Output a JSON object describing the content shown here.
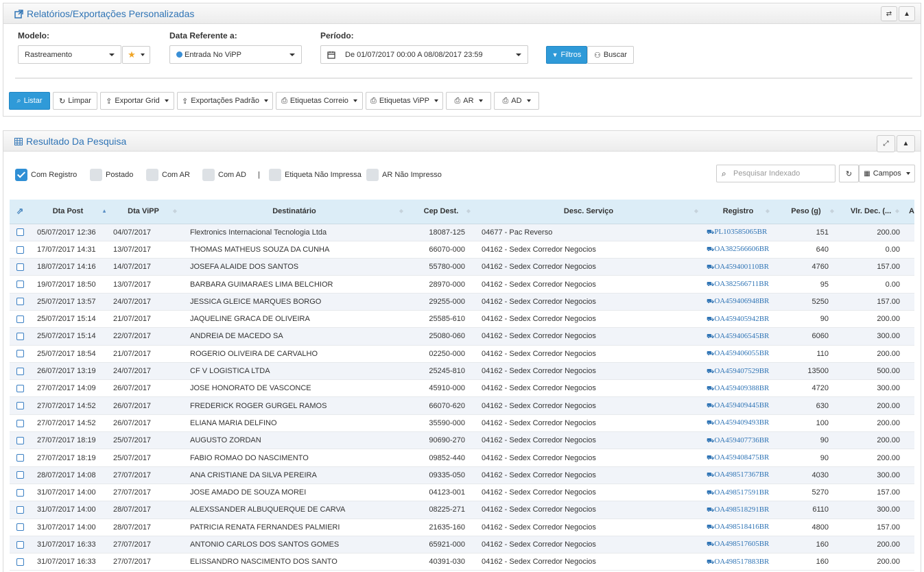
{
  "top_panel": {
    "title": "Relatórios/Exportações Personalizadas",
    "modelo": {
      "label": "Modelo:",
      "value": "Rastreamento"
    },
    "data_ref": {
      "label": "Data Referente a:",
      "value": "Entrada No ViPP"
    },
    "periodo": {
      "label": "Período:",
      "value": "De 01/07/2017 00:00 A 08/08/2017 23:59"
    },
    "filtros_label": "Filtros",
    "buscar_label": "Buscar",
    "toolbar": {
      "listar": "Listar",
      "limpar": "Limpar",
      "exportar_grid": "Exportar Grid",
      "exportacoes_padrao": "Exportações Padrão",
      "etiquetas_correio": "Etiquetas Correio",
      "etiquetas_vipp": "Etiquetas ViPP",
      "ar": "AR",
      "ad": "AD"
    }
  },
  "result_panel": {
    "title": "Resultado Da Pesquisa",
    "filters": [
      {
        "label": "Com Registro",
        "checked": true
      },
      {
        "label": "Postado",
        "checked": false
      },
      {
        "label": "Com AR",
        "checked": false
      },
      {
        "label": "Com AD",
        "checked": false
      },
      {
        "label": "Etiqueta Não Impressa",
        "checked": false
      },
      {
        "label": "AR Não Impresso",
        "checked": false
      }
    ],
    "separator": "|",
    "search_placeholder": "Pesquisar Indexado",
    "campos_label": "Campos",
    "columns": [
      "Dta Post",
      "Dta ViPP",
      "Destinatário",
      "Cep Dest.",
      "Desc. Serviço",
      "Registro",
      "Peso (g)",
      "Vlr. Dec. (...",
      "Adic"
    ],
    "rows": [
      [
        "05/07/2017 12:36",
        "04/07/2017",
        "Flextronics Internacional Tecnologia Ltda",
        "18087-125",
        "04677 - Pac Reverso",
        "PL103585065BR",
        "151",
        "200.00"
      ],
      [
        "17/07/2017 14:31",
        "13/07/2017",
        "THOMAS MATHEUS SOUZA DA CUNHA",
        "66070-000",
        "04162 - Sedex Corredor Negocios",
        "OA382566606BR",
        "640",
        "0.00"
      ],
      [
        "18/07/2017 14:16",
        "14/07/2017",
        "JOSEFA ALAIDE DOS SANTOS",
        "55780-000",
        "04162 - Sedex Corredor Negocios",
        "OA459400110BR",
        "4760",
        "157.00"
      ],
      [
        "19/07/2017 18:50",
        "13/07/2017",
        "BARBARA GUIMARAES LIMA BELCHIOR",
        "28970-000",
        "04162 - Sedex Corredor Negocios",
        "OA382566711BR",
        "95",
        "0.00"
      ],
      [
        "25/07/2017 13:57",
        "24/07/2017",
        "JESSICA GLEICE MARQUES BORGO",
        "29255-000",
        "04162 - Sedex Corredor Negocios",
        "OA459406948BR",
        "5250",
        "157.00"
      ],
      [
        "25/07/2017 15:14",
        "21/07/2017",
        "JAQUELINE GRACA DE OLIVEIRA",
        "25585-610",
        "04162 - Sedex Corredor Negocios",
        "OA459405942BR",
        "90",
        "200.00"
      ],
      [
        "25/07/2017 15:14",
        "22/07/2017",
        "ANDREIA DE MACEDO SA",
        "25080-060",
        "04162 - Sedex Corredor Negocios",
        "OA459406545BR",
        "6060",
        "300.00"
      ],
      [
        "25/07/2017 18:54",
        "21/07/2017",
        "ROGERIO OLIVEIRA DE CARVALHO",
        "02250-000",
        "04162 - Sedex Corredor Negocios",
        "OA459406055BR",
        "110",
        "200.00"
      ],
      [
        "26/07/2017 13:19",
        "24/07/2017",
        "CF V LOGISTICA LTDA",
        "25245-810",
        "04162 - Sedex Corredor Negocios",
        "OA459407529BR",
        "13500",
        "500.00"
      ],
      [
        "27/07/2017 14:09",
        "26/07/2017",
        "JOSE HONORATO DE VASCONCE",
        "45910-000",
        "04162 - Sedex Corredor Negocios",
        "OA459409388BR",
        "4720",
        "300.00"
      ],
      [
        "27/07/2017 14:52",
        "26/07/2017",
        "FREDERICK ROGER GURGEL RAMOS",
        "66070-620",
        "04162 - Sedex Corredor Negocios",
        "OA459409445BR",
        "630",
        "200.00"
      ],
      [
        "27/07/2017 14:52",
        "26/07/2017",
        "ELIANA MARIA DELFINO",
        "35590-000",
        "04162 - Sedex Corredor Negocios",
        "OA459409493BR",
        "100",
        "200.00"
      ],
      [
        "27/07/2017 18:19",
        "25/07/2017",
        "AUGUSTO ZORDAN",
        "90690-270",
        "04162 - Sedex Corredor Negocios",
        "OA459407736BR",
        "90",
        "200.00"
      ],
      [
        "27/07/2017 18:19",
        "25/07/2017",
        "FABIO ROMAO DO NASCIMENTO",
        "09852-440",
        "04162 - Sedex Corredor Negocios",
        "OA459408475BR",
        "90",
        "200.00"
      ],
      [
        "28/07/2017 14:08",
        "27/07/2017",
        "ANA CRISTIANE DA SILVA PEREIRA",
        "09335-050",
        "04162 - Sedex Corredor Negocios",
        "OA498517367BR",
        "4030",
        "300.00"
      ],
      [
        "31/07/2017 14:00",
        "27/07/2017",
        "JOSE AMADO DE SOUZA MOREI",
        "04123-001",
        "04162 - Sedex Corredor Negocios",
        "OA498517591BR",
        "5270",
        "157.00"
      ],
      [
        "31/07/2017 14:00",
        "28/07/2017",
        "ALEXSSANDER ALBUQUERQUE DE CARVA",
        "08225-271",
        "04162 - Sedex Corredor Negocios",
        "OA498518291BR",
        "6110",
        "300.00"
      ],
      [
        "31/07/2017 14:00",
        "28/07/2017",
        "PATRICIA RENATA FERNANDES PALMIERI",
        "21635-160",
        "04162 - Sedex Corredor Negocios",
        "OA498518416BR",
        "4800",
        "157.00"
      ],
      [
        "31/07/2017 16:33",
        "27/07/2017",
        "ANTONIO CARLOS DOS SANTOS GOMES",
        "65921-000",
        "04162 - Sedex Corredor Negocios",
        "OA498517605BR",
        "160",
        "200.00"
      ],
      [
        "31/07/2017 16:33",
        "27/07/2017",
        "ELISSANDRO NASCIMENTO DOS SANTO",
        "40391-030",
        "04162 - Sedex Corredor Negocios",
        "OA498517883BR",
        "160",
        "200.00"
      ]
    ]
  },
  "colors": {
    "accent": "#2f9ad8",
    "link": "#2f74b5",
    "header_bg": "#dcedf7",
    "row_alt": "#f1f4f9"
  }
}
